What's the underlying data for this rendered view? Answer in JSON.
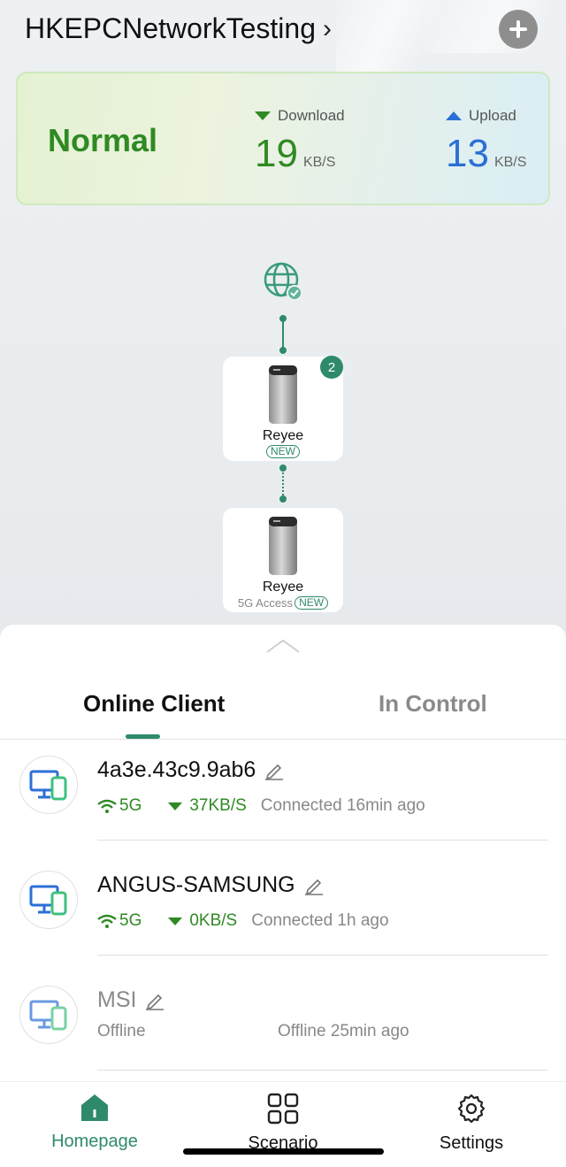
{
  "header": {
    "network_name": "HKEPCNetworkTesting",
    "chevron_icon": "chevron-right-icon",
    "add_icon": "plus-icon"
  },
  "status": {
    "state": "Normal",
    "download": {
      "label": "Download",
      "value": "19",
      "unit": "KB/S"
    },
    "upload": {
      "label": "Upload",
      "value": "13",
      "unit": "KB/S"
    }
  },
  "topology": {
    "internet_icon": "globe-check-icon",
    "devices": [
      {
        "name": "Reyee",
        "tag": "NEW",
        "badge": "2"
      },
      {
        "name": "Reyee",
        "sub": "5G Access",
        "tag": "NEW"
      }
    ]
  },
  "tabs": {
    "online_client": "Online Client",
    "in_control": "In Control"
  },
  "clients": [
    {
      "name": "4a3e.43c9.9ab6",
      "band": "5G",
      "speed": "37KB/S",
      "status": "Connected 16min ago"
    },
    {
      "name": "ANGUS-SAMSUNG",
      "band": "5G",
      "speed": "0KB/S",
      "status": "Connected 1h ago"
    },
    {
      "name": "MSI",
      "band": "Offline",
      "status": "Offline 25min ago"
    }
  ],
  "nav": {
    "home": "Homepage",
    "scenario": "Scenario",
    "settings": "Settings"
  },
  "colors": {
    "accent": "#2f8a6c",
    "green": "#2f8a23",
    "blue": "#2b6fd6"
  }
}
